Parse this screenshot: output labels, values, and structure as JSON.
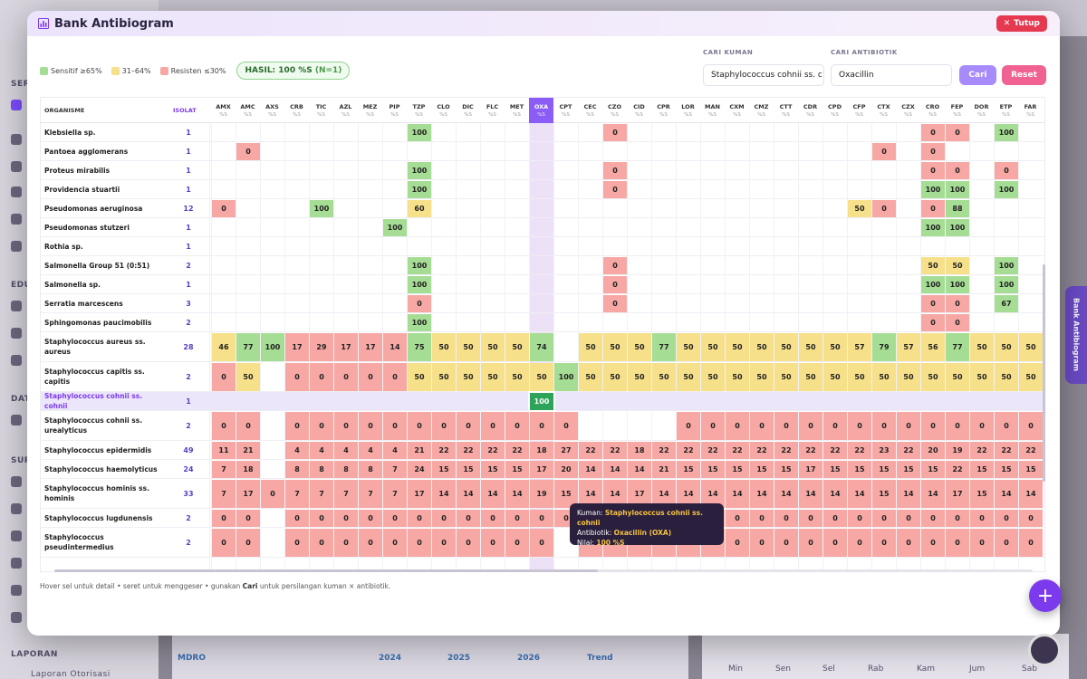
{
  "modal": {
    "title": "Bank Antibiogram",
    "close_label": "Tutup"
  },
  "legend": {
    "sensitive": "Sensitif ≥65%",
    "intermediate": "31–64%",
    "resistant": "Resisten ≤30%",
    "result_label": "HASIL:",
    "result_value": "100 %S",
    "result_n": "(N=1)"
  },
  "colors": {
    "sensitive": "#a6dd94",
    "intermediate": "#f7e08a",
    "resistant": "#f7a8a4",
    "accent": "#7c3aed"
  },
  "search": {
    "kuman_label": "CARI KUMAN",
    "kuman_value": "Staphylococcus cohnii ss. c",
    "antibiotik_label": "CARI ANTIBIOTIK",
    "antibiotik_value": "Oxacillin",
    "cari_label": "Cari",
    "reset_label": "Reset"
  },
  "table": {
    "col_name": "ORGANISME",
    "col_isolat": "ISOLAT",
    "unit": "%S",
    "antibiotics": [
      "AMX",
      "AMC",
      "AXS",
      "CRB",
      "TIC",
      "AZL",
      "MEZ",
      "PIP",
      "TZP",
      "CLO",
      "DIC",
      "FLC",
      "MET",
      "OXA",
      "CPT",
      "CEC",
      "CZO",
      "CID",
      "CPR",
      "LOR",
      "MAN",
      "CXM",
      "CMZ",
      "CTT",
      "CDR",
      "CPD",
      "CFP",
      "CTX",
      "CZX",
      "CRO",
      "FEP",
      "DOR",
      "ETP",
      "FAR"
    ],
    "selected_antibiotic": "OXA",
    "rows": [
      {
        "name": "Klebsiella sp.",
        "isolat": "1",
        "cells": {
          "TZP": "100",
          "CZO": "0",
          "CRO": "0",
          "FEP": "0",
          "ETP": "100"
        }
      },
      {
        "name": "Pantoea agglomerans",
        "isolat": "1",
        "cells": {
          "AMC": "0",
          "CTX": "0",
          "CRO": "0"
        }
      },
      {
        "name": "Proteus mirabilis",
        "isolat": "1",
        "cells": {
          "TZP": "100",
          "CZO": "0",
          "CRO": "0",
          "FEP": "0",
          "ETP": "0"
        }
      },
      {
        "name": "Providencia stuartii",
        "isolat": "1",
        "cells": {
          "TZP": "100",
          "CZO": "0",
          "CRO": "100",
          "FEP": "100",
          "ETP": "100"
        }
      },
      {
        "name": "Pseudomonas aeruginosa",
        "isolat": "12",
        "cells": {
          "AMX": "0",
          "TIC": "100",
          "TZP": "60",
          "CFP": "50",
          "CTX": "0",
          "CRO": "0",
          "FEP": "88"
        }
      },
      {
        "name": "Pseudomonas stutzeri",
        "isolat": "1",
        "cells": {
          "PIP": "100",
          "CRO": "100",
          "FEP": "100"
        }
      },
      {
        "name": "Rothia sp.",
        "isolat": "1",
        "cells": {}
      },
      {
        "name": "Salmonella Group 51 (0:51)",
        "isolat": "2",
        "cells": {
          "TZP": "100",
          "CZO": "0",
          "CRO": "50",
          "FEP": "50",
          "ETP": "100"
        }
      },
      {
        "name": "Salmonella sp.",
        "isolat": "1",
        "cells": {
          "TZP": "100",
          "CZO": "0",
          "CRO": "100",
          "FEP": "100",
          "ETP": "100"
        }
      },
      {
        "name": "Serratia marcescens",
        "isolat": "3",
        "cells": {
          "TZP": "0",
          "CZO": "0",
          "CRO": "0",
          "FEP": "0",
          "ETP": "67"
        }
      },
      {
        "name": "Sphingomonas paucimobilis",
        "isolat": "2",
        "cells": {
          "TZP": "100",
          "CRO": "0",
          "FEP": "0"
        }
      },
      {
        "name": "Staphylococcus aureus ss. aureus",
        "isolat": "28",
        "cells": {
          "AMX": "46",
          "AMC": "77",
          "AXS": "100",
          "CRB": "17",
          "TIC": "29",
          "AZL": "17",
          "MEZ": "17",
          "PIP": "14",
          "TZP": "75",
          "CLO": "50",
          "DIC": "50",
          "FLC": "50",
          "MET": "50",
          "OXA": "74",
          "CEC": "50",
          "CZO": "50",
          "CID": "50",
          "CPR": "77",
          "LOR": "50",
          "MAN": "50",
          "CXM": "50",
          "CMZ": "50",
          "CTT": "50",
          "CDR": "50",
          "CPD": "50",
          "CFP": "57",
          "CTX": "79",
          "CZX": "57",
          "CRO": "56",
          "FEP": "77",
          "DOR": "50",
          "ETP": "50",
          "FAR": "50"
        }
      },
      {
        "name": "Staphylococcus capitis ss. capitis",
        "isolat": "2",
        "cells": {
          "AMX": "0",
          "AMC": "50",
          "CRB": "0",
          "TIC": "0",
          "AZL": "0",
          "MEZ": "0",
          "PIP": "0",
          "TZP": "50",
          "CLO": "50",
          "DIC": "50",
          "FLC": "50",
          "MET": "50",
          "OXA": "50",
          "CPT": "100",
          "CEC": "50",
          "CZO": "50",
          "CID": "50",
          "CPR": "50",
          "LOR": "50",
          "MAN": "50",
          "CXM": "50",
          "CMZ": "50",
          "CTT": "50",
          "CDR": "50",
          "CPD": "50",
          "CFP": "50",
          "CTX": "50",
          "CZX": "50",
          "CRO": "50",
          "FEP": "50",
          "DOR": "50",
          "ETP": "50",
          "FAR": "50"
        }
      },
      {
        "name": "Staphylococcus cohnii ss. cohnii",
        "isolat": "1",
        "highlight": true,
        "cells": {
          "OXA": "100"
        }
      },
      {
        "name": "Staphylococcus cohnii ss. urealyticus",
        "isolat": "2",
        "cells": {
          "AMX": "0",
          "AMC": "0",
          "CRB": "0",
          "TIC": "0",
          "AZL": "0",
          "MEZ": "0",
          "PIP": "0",
          "TZP": "0",
          "CLO": "0",
          "DIC": "0",
          "FLC": "0",
          "MET": "0",
          "OXA": "0",
          "CPT": "0",
          "LOR": "0",
          "MAN": "0",
          "CXM": "0",
          "CMZ": "0",
          "CTT": "0",
          "CDR": "0",
          "CPD": "0",
          "CFP": "0",
          "CTX": "0",
          "CZX": "0",
          "CRO": "0",
          "FEP": "0",
          "DOR": "0",
          "ETP": "0",
          "FAR": "0"
        }
      },
      {
        "name": "Staphylococcus epidermidis",
        "isolat": "49",
        "cells": {
          "AMX": "11",
          "AMC": "21",
          "CRB": "4",
          "TIC": "4",
          "AZL": "4",
          "MEZ": "4",
          "PIP": "4",
          "TZP": "21",
          "CLO": "22",
          "DIC": "22",
          "FLC": "22",
          "MET": "22",
          "OXA": "18",
          "CPT": "27",
          "CEC": "22",
          "CZO": "22",
          "CID": "18",
          "CPR": "22",
          "LOR": "22",
          "MAN": "22",
          "CXM": "22",
          "CMZ": "22",
          "CTT": "22",
          "CDR": "22",
          "CPD": "22",
          "CFP": "22",
          "CTX": "23",
          "CZX": "22",
          "CRO": "20",
          "FEP": "19",
          "DOR": "22",
          "ETP": "22",
          "FAR": "22"
        }
      },
      {
        "name": "Staphylococcus haemolyticus",
        "isolat": "24",
        "cells": {
          "AMX": "7",
          "AMC": "18",
          "CRB": "8",
          "TIC": "8",
          "AZL": "8",
          "MEZ": "8",
          "PIP": "7",
          "TZP": "24",
          "CLO": "15",
          "DIC": "15",
          "FLC": "15",
          "MET": "15",
          "OXA": "17",
          "CPT": "20",
          "CEC": "14",
          "CZO": "14",
          "CID": "14",
          "CPR": "21",
          "LOR": "15",
          "MAN": "15",
          "CXM": "15",
          "CMZ": "15",
          "CTT": "15",
          "CDR": "17",
          "CPD": "15",
          "CFP": "15",
          "CTX": "15",
          "CZX": "15",
          "CRO": "15",
          "FEP": "22",
          "DOR": "15",
          "ETP": "15",
          "FAR": "15"
        }
      },
      {
        "name": "Staphylococcus hominis ss. hominis",
        "isolat": "33",
        "cells": {
          "AMX": "7",
          "AMC": "17",
          "AXS": "0",
          "CRB": "7",
          "TIC": "7",
          "AZL": "7",
          "MEZ": "7",
          "PIP": "7",
          "TZP": "17",
          "CLO": "14",
          "DIC": "14",
          "FLC": "14",
          "MET": "14",
          "OXA": "19",
          "CPT": "15",
          "CEC": "14",
          "CZO": "14",
          "CID": "17",
          "CPR": "14",
          "LOR": "14",
          "MAN": "14",
          "CXM": "14",
          "CMZ": "14",
          "CTT": "14",
          "CDR": "14",
          "CPD": "14",
          "CFP": "14",
          "CTX": "15",
          "CZX": "14",
          "CRO": "14",
          "FEP": "17",
          "DOR": "15",
          "ETP": "14",
          "FAR": "14"
        }
      },
      {
        "name": "Staphylococcus lugdunensis",
        "isolat": "2",
        "cells": {
          "AMX": "0",
          "AMC": "0",
          "CRB": "0",
          "TIC": "0",
          "AZL": "0",
          "MEZ": "0",
          "PIP": "0",
          "TZP": "0",
          "CLO": "0",
          "DIC": "0",
          "FLC": "0",
          "MET": "0",
          "OXA": "0",
          "CPT": "0",
          "CEC": "0",
          "CZO": "0",
          "CID": "0",
          "CPR": "0",
          "LOR": "0",
          "MAN": "0",
          "CXM": "0",
          "CMZ": "0",
          "CTT": "0",
          "CDR": "0",
          "CPD": "0",
          "CFP": "0",
          "CTX": "0",
          "CZX": "0",
          "CRO": "0",
          "FEP": "0",
          "DOR": "0",
          "ETP": "0",
          "FAR": "0"
        }
      },
      {
        "name": "Staphylococcus pseudintermedius",
        "isolat": "2",
        "cells": {
          "AMX": "0",
          "AMC": "0",
          "CRB": "0",
          "TIC": "0",
          "AZL": "0",
          "MEZ": "0",
          "PIP": "0",
          "TZP": "0",
          "CLO": "0",
          "DIC": "0",
          "FLC": "0",
          "MET": "0",
          "OXA": "0",
          "CEC": "0",
          "CZO": "0",
          "CID": "0",
          "CPR": "0",
          "LOR": "0",
          "MAN": "0",
          "CXM": "0",
          "CMZ": "0",
          "CTT": "0",
          "CDR": "0",
          "CPD": "0",
          "CFP": "0",
          "CTX": "0",
          "CZX": "0",
          "CRO": "0",
          "FEP": "0",
          "DOR": "0",
          "ETP": "0",
          "FAR": "0"
        }
      }
    ]
  },
  "tooltip": {
    "kuman_label": "Kuman:",
    "kuman_value": "Staphylococcus cohnii ss. cohnii",
    "antibiotik_label": "Antibiotik:",
    "antibiotik_value": "Oxacillin (OXA)",
    "nilai_label": "Nilai:",
    "nilai_value": "100 %S"
  },
  "hint": {
    "text_before": "Hover sel untuk detail • seret untuk menggeser • gunakan ",
    "bold": "Cari",
    "text_after": " untuk persilangan kuman × antibiotik."
  },
  "side_tab_label": "Bank Antibiogram",
  "background": {
    "sections": [
      "SER",
      "EDU",
      "DAT",
      "SUP",
      "LAPORAN"
    ],
    "report_item": "Laporan Otorisasi",
    "table_headers": [
      "MDRO",
      "2024",
      "2025",
      "2026",
      "Trend"
    ],
    "days": [
      "Min",
      "Sen",
      "Sel",
      "Rab",
      "Kam",
      "Jum",
      "Sab"
    ]
  }
}
